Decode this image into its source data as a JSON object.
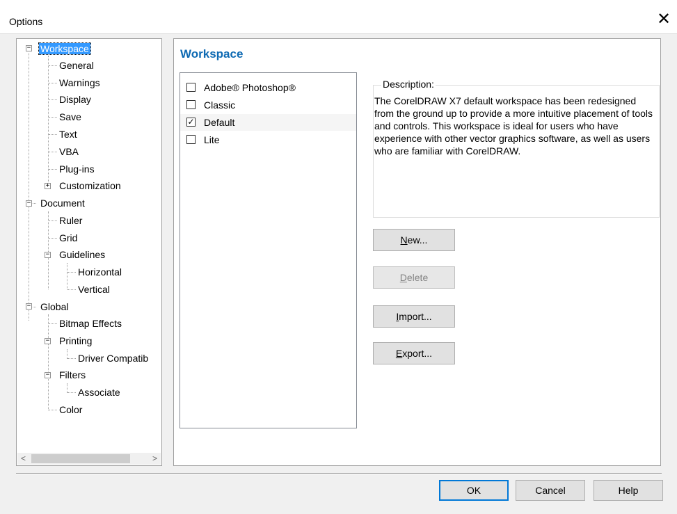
{
  "window": {
    "title": "Options",
    "close_glyph": "✕"
  },
  "tree": {
    "items": [
      {
        "label": "Workspace",
        "selected": true
      },
      {
        "label": "General"
      },
      {
        "label": "Warnings"
      },
      {
        "label": "Display"
      },
      {
        "label": "Save"
      },
      {
        "label": "Text"
      },
      {
        "label": "VBA"
      },
      {
        "label": "Plug-ins"
      },
      {
        "label": "Customization",
        "expander": "+"
      },
      {
        "label": "Document"
      },
      {
        "label": "Ruler"
      },
      {
        "label": "Grid"
      },
      {
        "label": "Guidelines"
      },
      {
        "label": "Horizontal"
      },
      {
        "label": "Vertical"
      },
      {
        "label": "Global"
      },
      {
        "label": "Bitmap Effects"
      },
      {
        "label": "Printing"
      },
      {
        "label": "Driver Compatib"
      },
      {
        "label": "Filters"
      },
      {
        "label": "Associate"
      },
      {
        "label": "Color"
      }
    ],
    "scroll_left": "<",
    "scroll_right": ">"
  },
  "main": {
    "title": "Workspace",
    "workspaces": [
      {
        "name": "Adobe® Photoshop®",
        "checked": false
      },
      {
        "name": "Classic",
        "checked": false
      },
      {
        "name": "Default",
        "checked": true
      },
      {
        "name": "Lite",
        "checked": false
      }
    ],
    "description_label": "Description:",
    "description": "The CorelDRAW X7 default workspace has been redesigned from the ground up to provide a more intuitive placement of tools and controls. This workspace is ideal for users who have experience with other vector graphics software, as well as users who are familiar with CorelDRAW.",
    "buttons": {
      "new": {
        "mnemonic": "N",
        "rest": "ew..."
      },
      "delete": {
        "mnemonic": "D",
        "rest": "elete"
      },
      "import": {
        "mnemonic": "I",
        "rest": "mport..."
      },
      "export": {
        "mnemonic": "E",
        "rest": "xport..."
      }
    }
  },
  "footer": {
    "ok": "OK",
    "cancel": "Cancel",
    "help": "Help"
  },
  "colors": {
    "accent": "#0e6ab3",
    "selection": "#3399ff",
    "default_button_border": "#0078d7"
  }
}
